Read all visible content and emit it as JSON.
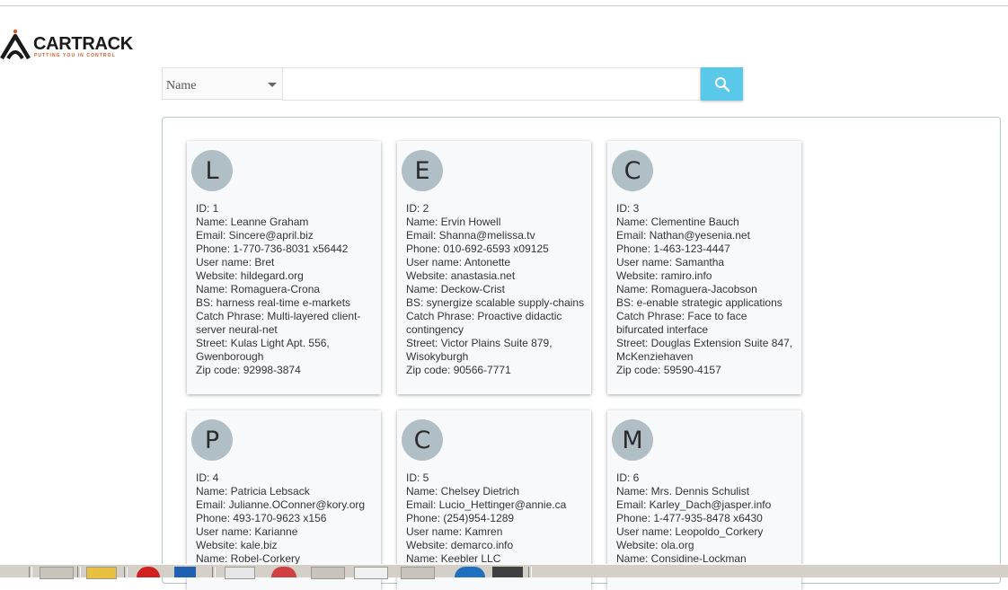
{
  "brand": {
    "name": "CARTRACK",
    "tagline": "PUTTING YOU IN CONTROL",
    "accent": "#e0531f"
  },
  "search": {
    "field_select": "Name",
    "query": "",
    "button_icon": "search-icon",
    "button_color": "#5ac8e8"
  },
  "users": [
    {
      "initial": "L",
      "lines": [
        "ID: 1",
        "Name: Leanne Graham",
        "Email: Sincere@april.biz",
        "Phone: 1-770-736-8031 x56442",
        "User name: Bret",
        "Website: hildegard.org",
        "Name: Romaguera-Crona",
        "BS: harness real-time e-markets",
        "Catch Phrase: Multi-layered client-server neural-net",
        "Street: Kulas Light Apt. 556, Gwenborough",
        "Zip code: 92998-3874"
      ]
    },
    {
      "initial": "E",
      "lines": [
        "ID: 2",
        "Name: Ervin Howell",
        "Email: Shanna@melissa.tv",
        "Phone: 010-692-6593 x09125",
        "User name: Antonette",
        "Website: anastasia.net",
        "Name: Deckow-Crist",
        "BS: synergize scalable supply-chains",
        "Catch Phrase: Proactive didactic contingency",
        "Street: Victor Plains Suite 879, Wisokyburgh",
        "Zip code: 90566-7771"
      ]
    },
    {
      "initial": "C",
      "lines": [
        "ID: 3",
        "Name: Clementine Bauch",
        "Email: Nathan@yesenia.net",
        "Phone: 1-463-123-4447",
        "User name: Samantha",
        "Website: ramiro.info",
        "Name: Romaguera-Jacobson",
        "BS: e-enable strategic applications",
        "Catch Phrase: Face to face bifurcated interface",
        "Street: Douglas Extension Suite 847, McKenziehaven",
        "Zip code: 59590-4157"
      ]
    },
    {
      "initial": "P",
      "lines": [
        "ID: 4",
        "Name: Patricia Lebsack",
        "Email: Julianne.OConner@kory.org",
        "Phone: 493-170-9623 x156",
        "User name: Karianne",
        "Website: kale.biz",
        "Name: Robel-Corkery"
      ]
    },
    {
      "initial": "C",
      "lines": [
        "ID: 5",
        "Name: Chelsey Dietrich",
        "Email: Lucio_Hettinger@annie.ca",
        "Phone: (254)954-1289",
        "User name: Kamren",
        "Website: demarco.info",
        "Name: Keebler LLC"
      ]
    },
    {
      "initial": "M",
      "lines": [
        "ID: 6",
        "Name: Mrs. Dennis Schulist",
        "Email: Karley_Dach@jasper.info",
        "Phone: 1-477-935-8478 x6430",
        "User name: Leopoldo_Corkery",
        "Website: ola.org",
        "Name: Considine-Lockman"
      ]
    }
  ]
}
